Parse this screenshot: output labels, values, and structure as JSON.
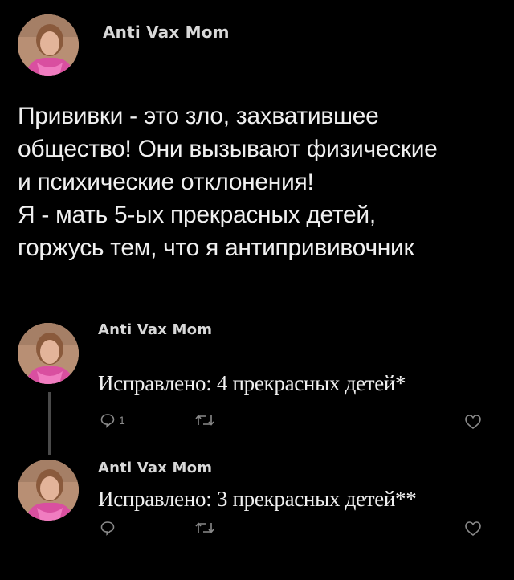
{
  "main_tweet": {
    "author": "Anti Vax Mom",
    "lines": [
      "Прививки - это зло, захватившее",
      "общество! Они вызывают физические",
      "и психические отклонения!",
      "Я - мать 5-ых прекрасных детей,",
      "горжусь тем, что я антипрививочник"
    ]
  },
  "replies": [
    {
      "author": "Anti Vax Mom",
      "text": "Исправлено: 4 прекрасных детей*",
      "reply_count": "1"
    },
    {
      "author": "Anti Vax Mom",
      "text": "Исправлено: 3 прекрасных детей**",
      "reply_count": ""
    }
  ],
  "icons": {
    "reply": "reply-bubble-icon",
    "retweet": "retweet-icon",
    "like": "heart-icon"
  },
  "colors": {
    "background": "#000000",
    "text": "#f0f0f0",
    "muted": "#8a8a8a"
  }
}
